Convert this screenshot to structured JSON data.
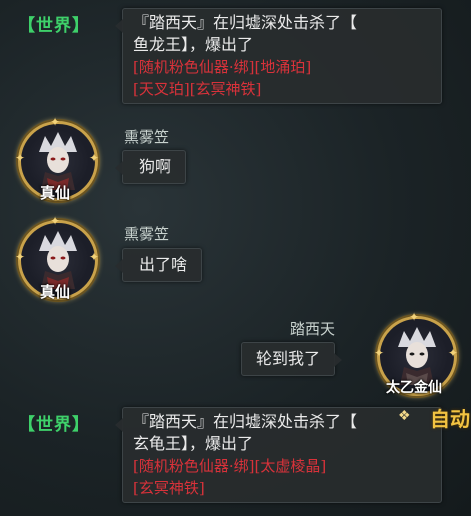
{
  "colors": {
    "world_tag": "#3ed06a",
    "item_red": "#d8323a",
    "rank_gold": "#c9a24a"
  },
  "messages": [
    {
      "channel": "【世界】",
      "lines": [
        "『踏西天』在归墟深处击杀了【",
        "鱼龙王】，爆出了"
      ],
      "items": [
        "[随机粉色仙器·绑][地涌珀]",
        "[天叉珀][玄冥神铁]"
      ]
    },
    {
      "sender": "熏雾笠",
      "rank": "真仙",
      "text": "狗啊"
    },
    {
      "sender": "熏雾笠",
      "rank": "真仙",
      "text": "出了啥"
    },
    {
      "sender": "踏西天",
      "rank": "太乙金仙",
      "text": "轮到我了"
    },
    {
      "channel": "【世界】",
      "lines": [
        "『踏西天』在归墟深处击杀了【",
        "玄龟王】，爆出了"
      ],
      "items": [
        "[随机粉色仙器·绑][太虚棱晶]",
        "[玄冥神铁]"
      ]
    }
  ],
  "overlay": {
    "auto_label": "自动"
  },
  "icons": {
    "avatar": "player-portrait-icon",
    "sparkle": "sparkle-icon"
  }
}
